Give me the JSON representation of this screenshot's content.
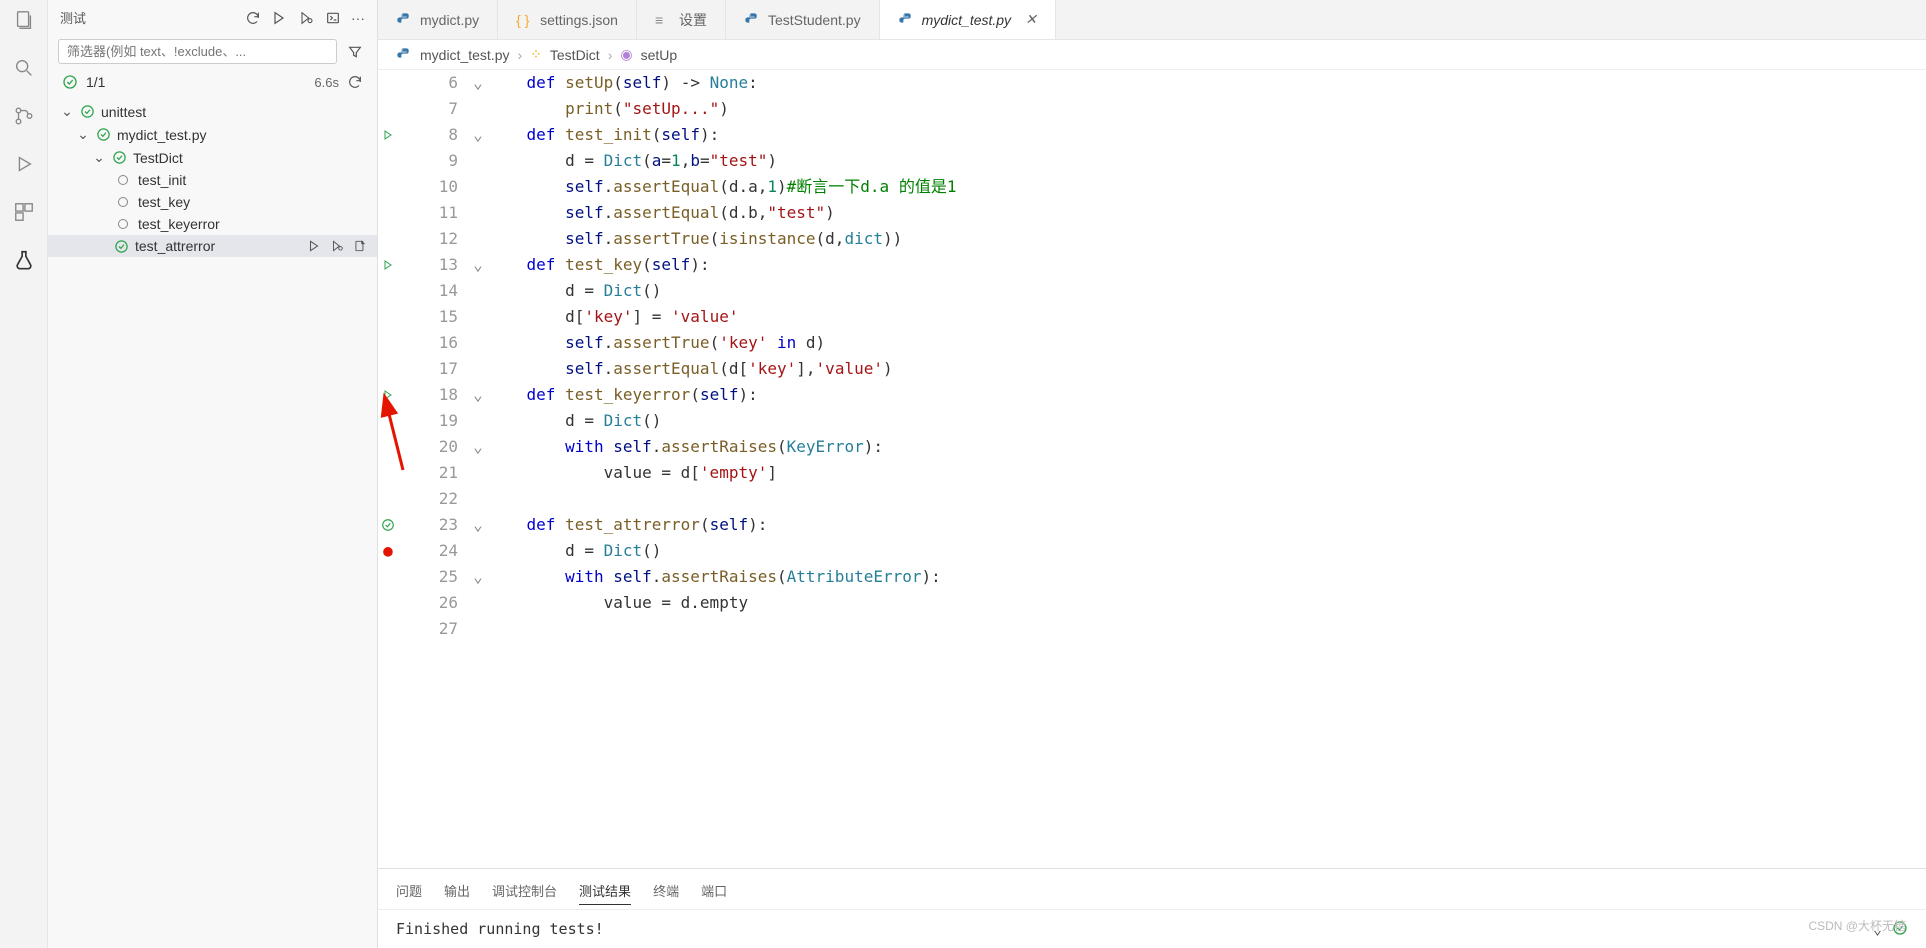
{
  "sidePanel": {
    "title": "测试",
    "filterPlaceholder": "筛选器(例如 text、!exclude、...",
    "summary": {
      "passed": "1/1",
      "time": "6.6s"
    },
    "tree": {
      "root": "unittest",
      "file": "mydict_test.py",
      "class": "TestDict",
      "tests": [
        "test_init",
        "test_key",
        "test_keyerror",
        "test_attrerror"
      ]
    }
  },
  "tabs": [
    {
      "label": "mydict.py",
      "type": "py"
    },
    {
      "label": "settings.json",
      "type": "json"
    },
    {
      "label": "设置",
      "type": "settings"
    },
    {
      "label": "TestStudent.py",
      "type": "py"
    },
    {
      "label": "mydict_test.py",
      "type": "py",
      "active": true
    }
  ],
  "breadcrumb": {
    "file": "mydict_test.py",
    "class": "TestDict",
    "method": "setUp"
  },
  "code": {
    "startLine": 6,
    "lines": [
      {
        "n": 6,
        "fold": true,
        "html": "    <span class='kw'>def</span> <span class='fn'>setUp</span>(<span class='param'>self</span>) -> <span class='none'>None</span>:"
      },
      {
        "n": 7,
        "html": "        <span class='fn'>print</span>(<span class='str'>\"setUp...\"</span>)"
      },
      {
        "n": 8,
        "deco": "play",
        "fold": true,
        "html": "    <span class='kw'>def</span> <span class='fn'>test_init</span>(<span class='param'>self</span>):"
      },
      {
        "n": 9,
        "html": "        d = <span class='cls'>Dict</span>(<span class='param'>a</span>=<span class='num'>1</span>,<span class='param'>b</span>=<span class='str'>\"test\"</span>)"
      },
      {
        "n": 10,
        "html": "        <span class='param'>self</span>.<span class='fn'>assertEqual</span>(d.a,<span class='num'>1</span>)<span class='cm'>#断言一下d.a 的值是1</span>"
      },
      {
        "n": 11,
        "html": "        <span class='param'>self</span>.<span class='fn'>assertEqual</span>(d.b,<span class='str'>\"test\"</span>)"
      },
      {
        "n": 12,
        "html": "        <span class='param'>self</span>.<span class='fn'>assertTrue</span>(<span class='fn'>isinstance</span>(d,<span class='cls'>dict</span>))"
      },
      {
        "n": 13,
        "deco": "play",
        "fold": true,
        "html": "    <span class='kw'>def</span> <span class='fn'>test_key</span>(<span class='param'>self</span>):"
      },
      {
        "n": 14,
        "html": "        d = <span class='cls'>Dict</span>()"
      },
      {
        "n": 15,
        "html": "        d[<span class='str'>'key'</span>] = <span class='str'>'value'</span>"
      },
      {
        "n": 16,
        "html": "        <span class='param'>self</span>.<span class='fn'>assertTrue</span>(<span class='str'>'key'</span> <span class='kw'>in</span> d)"
      },
      {
        "n": 17,
        "html": "        <span class='param'>self</span>.<span class='fn'>assertEqual</span>(d[<span class='str'>'key'</span>],<span class='str'>'value'</span>)"
      },
      {
        "n": 18,
        "deco": "play",
        "fold": true,
        "html": "    <span class='kw'>def</span> <span class='fn'>test_keyerror</span>(<span class='param'>self</span>):"
      },
      {
        "n": 19,
        "html": "        d = <span class='cls'>Dict</span>()"
      },
      {
        "n": 20,
        "fold": true,
        "html": "        <span class='kw'>with</span> <span class='param'>self</span>.<span class='fn'>assertRaises</span>(<span class='cls'>KeyError</span>):"
      },
      {
        "n": 21,
        "html": "            value = d[<span class='str'>'empty'</span>]"
      },
      {
        "n": 22,
        "html": ""
      },
      {
        "n": 23,
        "deco": "check",
        "fold": true,
        "html": "    <span class='kw'>def</span> <span class='fn'>test_attrerror</span>(<span class='param'>self</span>):"
      },
      {
        "n": 24,
        "deco": "bp",
        "html": "        d = <span class='cls'>Dict</span>()"
      },
      {
        "n": 25,
        "fold": true,
        "html": "        <span class='kw'>with</span> <span class='param'>self</span>.<span class='fn'>assertRaises</span>(<span class='cls'>AttributeError</span>):"
      },
      {
        "n": 26,
        "html": "            value = d.empty"
      },
      {
        "n": 27,
        "html": ""
      }
    ]
  },
  "bottomPanel": {
    "tabs": [
      "问题",
      "输出",
      "调试控制台",
      "测试结果",
      "终端",
      "端口"
    ],
    "activeTab": "测试结果",
    "output": "Finished running tests!"
  },
  "watermark": "CSDN @大杯无糖"
}
